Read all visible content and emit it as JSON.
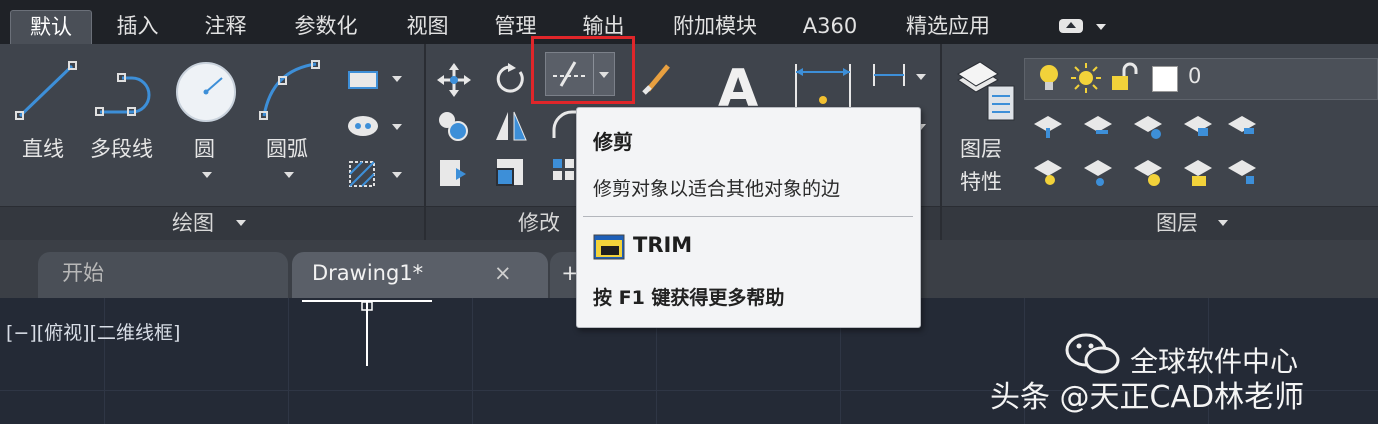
{
  "ribbon_tabs": [
    "默认",
    "插入",
    "注释",
    "参数化",
    "视图",
    "管理",
    "输出",
    "附加模块",
    "A360",
    "精选应用"
  ],
  "draw_panel": {
    "title": "绘图",
    "tools": {
      "line": "直线",
      "polyline": "多段线",
      "circle": "圆",
      "arc": "圆弧"
    }
  },
  "modify_panel": {
    "title": "修改"
  },
  "layer_panel": {
    "title": "图层",
    "layer_props_label_1": "图层",
    "layer_props_label_2": "特性",
    "current_layer": "0"
  },
  "tooltip": {
    "title": "修剪",
    "description": "修剪对象以适合其他对象的边",
    "command": "TRIM",
    "help": "按 F1 键获得更多帮助"
  },
  "file_tabs": {
    "start": "开始",
    "drawing": "Drawing1*",
    "close_glyph": "×",
    "new_glyph": "+"
  },
  "viewport_label": "[−][俯视][二维线框]",
  "watermark": {
    "line1": "全球软件中心",
    "line2": "头条 @天正CAD林老师"
  },
  "colors": {
    "highlight": "#e0262a",
    "accent_blue": "#3d8fd8",
    "bulb": "#f2d23a"
  }
}
